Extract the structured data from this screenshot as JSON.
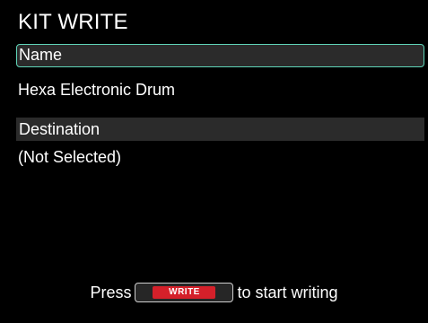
{
  "screen": {
    "title": "KIT WRITE"
  },
  "name_section": {
    "header": "Name",
    "value": "Hexa Electronic Drum"
  },
  "destination_section": {
    "header": "Destination",
    "value": "(Not Selected)"
  },
  "footer": {
    "prefix": "Press",
    "button_label": "WRITE",
    "suffix": "to start writing"
  },
  "colors": {
    "background": "#000000",
    "header_bg": "#2b2b2b",
    "selection_outline": "#5fd4b8",
    "write_button": "#d4202a",
    "text": "#ffffff"
  }
}
